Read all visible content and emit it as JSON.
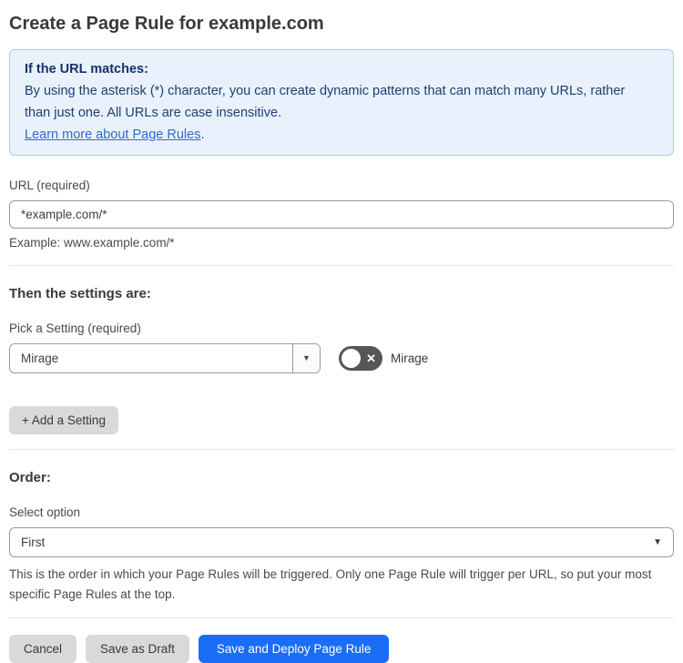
{
  "page": {
    "title": "Create a Page Rule for example.com"
  },
  "info_box": {
    "heading": "If the URL matches:",
    "body": "By using the asterisk (*) character, you can create dynamic patterns that can match many URLs, rather than just one. All URLs are case insensitive.",
    "link": "Learn more about Page Rules",
    "link_suffix": "."
  },
  "url_field": {
    "label": "URL (required)",
    "value": "*example.com/*",
    "helper": "Example: www.example.com/*"
  },
  "settings_section": {
    "heading": "Then the settings are:",
    "picker_label": "Pick a Setting (required)",
    "picker_value": "Mirage",
    "toggle_label": "Mirage",
    "toggle_state": "off",
    "add_button": "+ Add a Setting"
  },
  "order_section": {
    "heading": "Order:",
    "select_label": "Select option",
    "select_value": "First",
    "helper": "This is the order in which your Page Rules will be triggered. Only one Page Rule will trigger per URL, so put your most specific Page Rules at the top."
  },
  "footer": {
    "cancel": "Cancel",
    "save_draft": "Save as Draft",
    "save_deploy": "Save and Deploy Page Rule"
  },
  "icons": {
    "chevron_down": "▼",
    "x": "✕"
  },
  "colors": {
    "info_bg": "#e9f2fc",
    "info_border": "#a9c9ee",
    "info_text": "#1d3f74",
    "link": "#2e6bd0",
    "primary_button": "#1a6ef5",
    "secondary_button": "#d9d9d9",
    "toggle_off": "#565656"
  }
}
